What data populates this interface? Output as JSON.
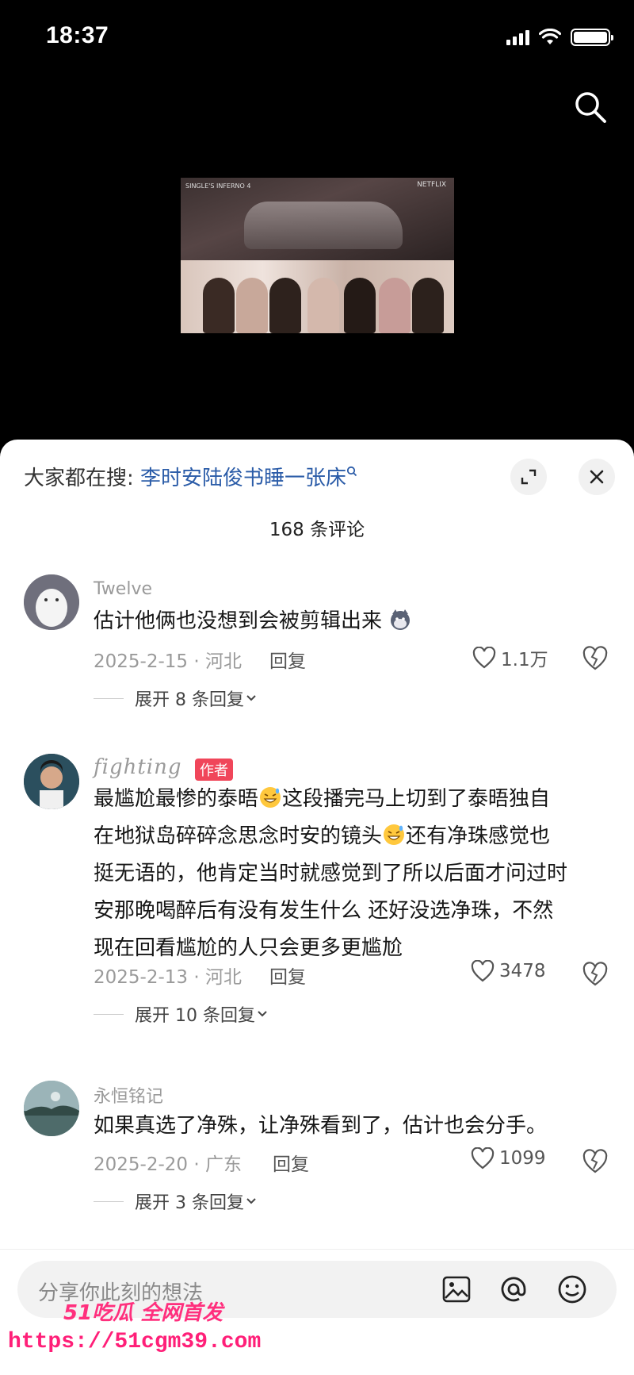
{
  "status": {
    "time": "18:37"
  },
  "video": {
    "show_logo": "SINGLE'S INFERNO 4",
    "brand": "NETFLIX"
  },
  "sheet": {
    "search_prefix": "大家都在搜: ",
    "search_term": "李时安陆俊书睡一张床",
    "comment_count": "168 条评论"
  },
  "comments": [
    {
      "username": "Twelve",
      "text": "估计他俩也没想到会被剪辑出来",
      "date_location": "2025-2-15 · 河北",
      "reply_label": "回复",
      "likes": "1.1万",
      "expand_label": "展开 8 条回复"
    },
    {
      "username": "fighting",
      "badge": "作者",
      "text_lines": [
        "最尴尬最惨的泰晤",
        "这段播完马上切到了泰晤独自",
        "在地狱岛碎碎念思念时安的镜头",
        "还有净珠感觉也",
        "挺无语的，他肯定当时就感觉到了所以后面才问过时",
        "安那晚喝醉后有没有发生什么 还好没选净珠，不然",
        "现在回看尴尬的人只会更多更尴尬"
      ],
      "date_location": "2025-2-13 · 河北",
      "reply_label": "回复",
      "likes": "3478",
      "expand_label": "展开 10 条回复"
    },
    {
      "username": "永恒铭记",
      "text": "如果真选了净殊，让净殊看到了，估计也会分手。",
      "date_location": "2025-2-20 · 广东",
      "reply_label": "回复",
      "likes": "1099",
      "expand_label": "展开 3 条回复"
    }
  ],
  "input": {
    "placeholder": "分享你此刻的想法"
  },
  "watermark": {
    "line1": "51吃瓜 全网首发",
    "line2": "https://51cgm39.com"
  },
  "colors": {
    "link": "#2b5ca8",
    "badge": "#f0465a",
    "watermark": "#ff1f78"
  }
}
